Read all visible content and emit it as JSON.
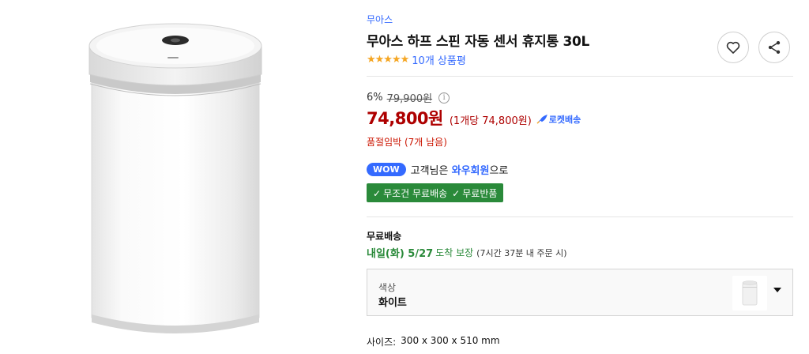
{
  "product": {
    "brand": "무아스",
    "title": "무아스 하프 스핀 자동 센서 휴지통 30L",
    "stars": "★★★★★",
    "review_count": "10개 상품평",
    "rating": 5
  },
  "price": {
    "discount_rate": "6%",
    "original": "79,900원",
    "sale": "74,800원",
    "unit": "(1개당 74,800원)",
    "delivery_badge": "로켓배송"
  },
  "stock": {
    "warning": "품절임박 (7개 남음)"
  },
  "membership": {
    "badge": "WOW",
    "text_prefix": "고객님은",
    "text_highlight": "와우회원",
    "text_suffix": "으로",
    "benefits": [
      "무조건 무료배송",
      "무료반품"
    ]
  },
  "shipping": {
    "label": "무료배송",
    "date": "내일(화) 5/27",
    "guarantee": "도착 보장",
    "condition": "(7시간 37분 내 주문 시)"
  },
  "option": {
    "label": "색상",
    "value": "화이트"
  },
  "size": {
    "label": "사이즈:",
    "value": "300 x 300 x 510 mm"
  },
  "icons": {
    "heart": "heart-icon",
    "share": "share-icon",
    "info": "info-icon",
    "rocket": "rocket-icon",
    "check": "check-icon",
    "dropdown": "chevron-down-icon"
  },
  "colors": {
    "accent_blue": "#346aff",
    "price_red": "#ae0000",
    "stock_red": "#cb1400",
    "benefit_green": "#2a8a3a",
    "star_orange": "#f5a623"
  }
}
